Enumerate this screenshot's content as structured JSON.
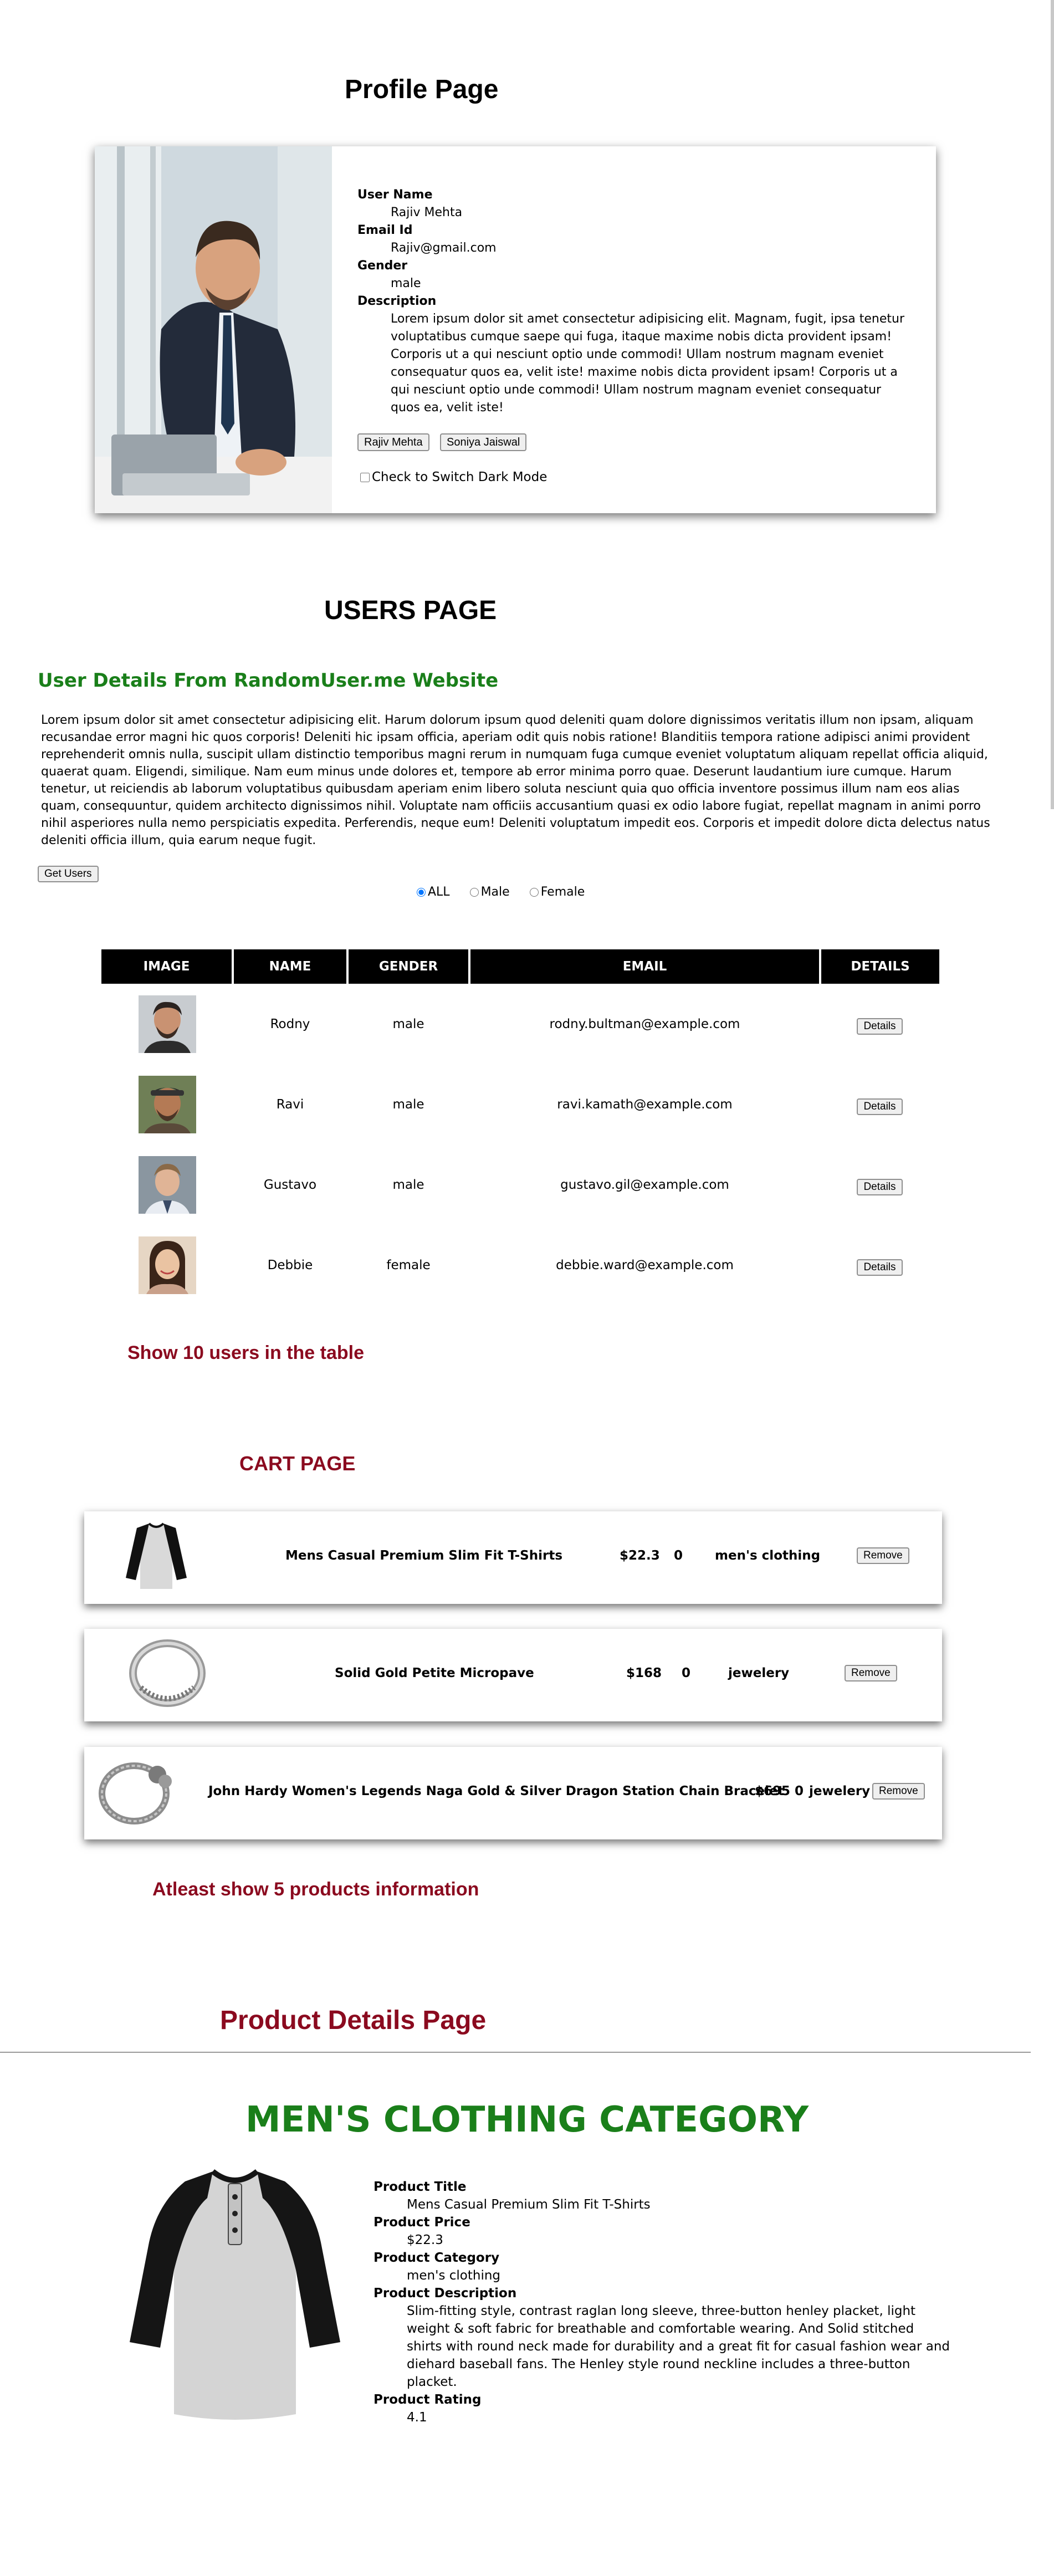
{
  "profile": {
    "title": "Profile Page",
    "user_name_label": "User Name",
    "user_name": "Rajiv Mehta",
    "email_label": "Email Id",
    "email": "Rajiv@gmail.com",
    "gender_label": "Gender",
    "gender": "male",
    "description_label": "Description",
    "description": "Lorem ipsum dolor sit amet consectetur adipisicing elit. Magnam, fugit, ipsa tenetur voluptatibus cumque saepe qui fuga, itaque maxime nobis dicta provident ipsam! Corporis ut a qui nesciunt optio unde commodi! Ullam nostrum magnam eveniet consequatur quos ea, velit iste! maxime nobis dicta provident ipsam! Corporis ut a qui nesciunt optio unde commodi! Ullam nostrum magnam eveniet consequatur quos ea, velit iste!",
    "button_1": "Rajiv Mehta",
    "button_2": "Soniya Jaiswal",
    "dark_mode_label": "Check to Switch Dark Mode"
  },
  "users": {
    "title": "USERS PAGE",
    "subtitle": "User Details From RandomUser.me Website",
    "paragraph": "Lorem ipsum dolor sit amet consectetur adipisicing elit. Harum dolorum ipsum quod deleniti quam dolore dignissimos veritatis illum non ipsam, aliquam recusandae error magni hic quos corporis! Deleniti hic ipsam officia, aperiam odit quis nobis ratione! Blanditiis tempora ratione adipisci animi provident reprehenderit omnis nulla, suscipit ullam distinctio temporibus magni rerum in numquam fuga cumque eveniet voluptatum aliquam repellat officia aliquid, quaerat quam. Eligendi, similique. Nam eum minus unde dolores et, tempore ab error minima porro quae. Deserunt laudantium iure cumque. Harum tenetur, ut reiciendis ab laborum voluptatibus quibusdam aperiam enim libero soluta nesciunt quia quo officia inventore possimus illum nam eos alias quam, consequuntur, quidem architecto dignissimos nihil. Voluptate nam officiis accusantium quasi ex odio labore fugiat, repellat magnam in animi porro nihil asperiores nulla nemo perspiciatis expedita. Perferendis, neque eum! Deleniti voluptatum impedit eos. Corporis et impedit dolore dicta delectus natus deleniti officia illum, quia earum neque fugit.",
    "get_users_button": "Get Users",
    "filters": [
      "ALL",
      "Male",
      "Female"
    ],
    "selected_filter": "ALL",
    "columns": [
      "IMAGE",
      "NAME",
      "GENDER",
      "EMAIL",
      "DETAILS"
    ],
    "rows": [
      {
        "name": "Rodny",
        "gender": "male",
        "email": "rodny.bultman@example.com",
        "action": "Details"
      },
      {
        "name": "Ravi",
        "gender": "male",
        "email": "ravi.kamath@example.com",
        "action": "Details"
      },
      {
        "name": "Gustavo",
        "gender": "male",
        "email": "gustavo.gil@example.com",
        "action": "Details"
      },
      {
        "name": "Debbie",
        "gender": "female",
        "email": "debbie.ward@example.com",
        "action": "Details"
      }
    ],
    "note": "Show 10 users in the table"
  },
  "cart": {
    "title": "CART PAGE",
    "items": [
      {
        "title": "Mens Casual Premium Slim Fit T-Shirts",
        "price": "$22.3",
        "qty": "0",
        "category": "men's clothing",
        "button": "Remove"
      },
      {
        "title": "Solid Gold Petite Micropave",
        "price": "$168",
        "qty": "0",
        "category": "jewelery",
        "button": "Remove"
      },
      {
        "title": "John Hardy Women's Legends Naga Gold & Silver Dragon Station Chain Bracelet",
        "price": "$695",
        "qty": "0",
        "category": "jewelery",
        "button": "Remove"
      }
    ],
    "note": "Atleast show 5 products information"
  },
  "product": {
    "page_title": "Product Details Page",
    "category_heading": "MEN'S CLOTHING CATEGORY",
    "title_label": "Product Title",
    "title": "Mens Casual Premium Slim Fit T-Shirts",
    "price_label": "Product Price",
    "price": "$22.3",
    "category_label": "Product Category",
    "category": "men's clothing",
    "description_label": "Product Description",
    "description": "Slim-fitting style, contrast raglan long sleeve, three-button henley placket, light weight & soft fabric for breathable and comfortable wearing. And Solid stitched shirts with round neck made for durability and a great fit for casual fashion wear and diehard baseball fans. The Henley style round neckline includes a three-button placket.",
    "rating_label": "Product Rating",
    "rating": "4.1"
  },
  "colors": {
    "green": "#1a7f1a",
    "maroon": "#8b0a1f",
    "table_header": "#000000"
  },
  "icons": [
    "profile-photo",
    "user-avatar",
    "tshirt-image",
    "ring-image",
    "bracelet-image"
  ]
}
